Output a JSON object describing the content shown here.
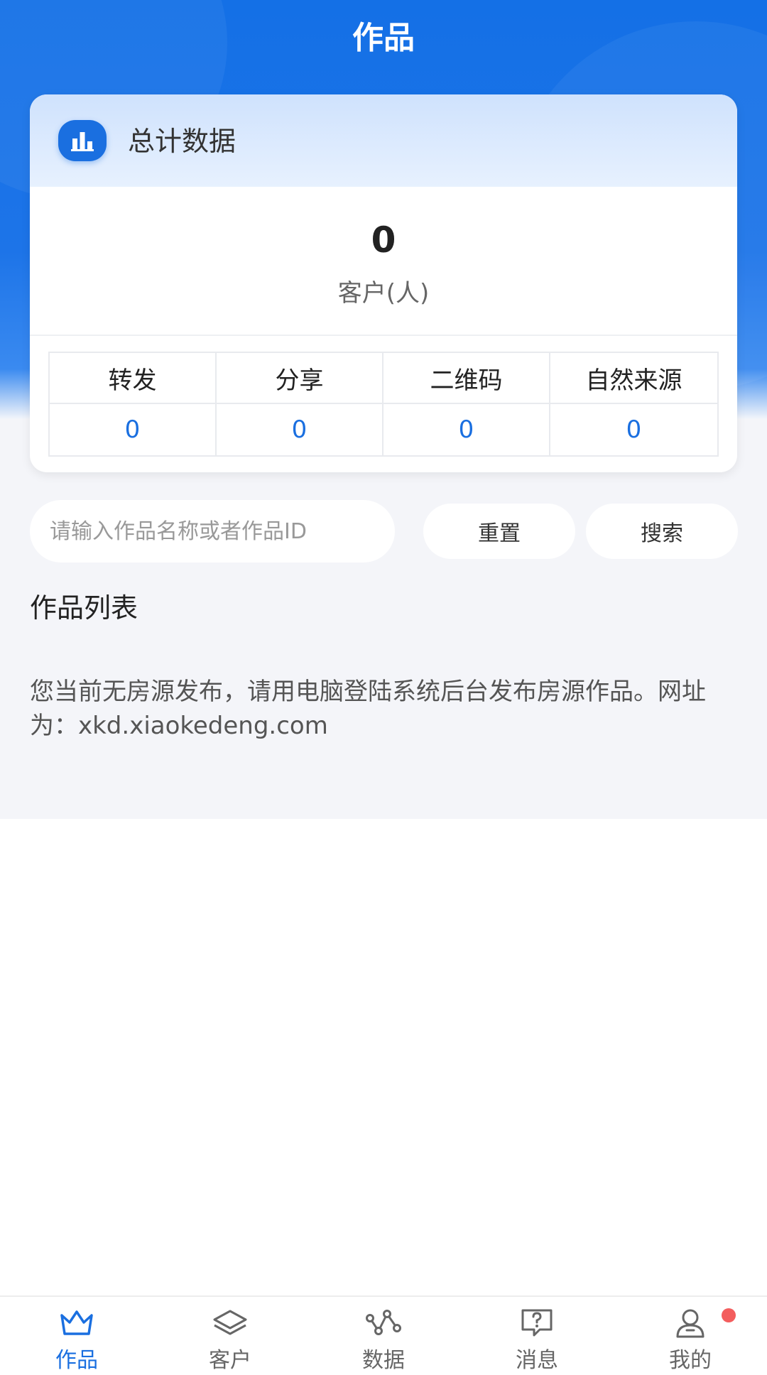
{
  "header": {
    "title": "作品"
  },
  "summary": {
    "title": "总计数据",
    "total_value": "0",
    "total_label": "客户(人)",
    "columns": [
      "转发",
      "分享",
      "二维码",
      "自然来源"
    ],
    "values": [
      "0",
      "0",
      "0",
      "0"
    ]
  },
  "search": {
    "placeholder": "请输入作品名称或者作品ID",
    "reset_label": "重置",
    "search_label": "搜索"
  },
  "list": {
    "title": "作品列表",
    "empty_text": "您当前无房源发布，请用电脑登陆系统后台发布房源作品。网址为：xkd.xiaokedeng.com"
  },
  "tabbar": {
    "items": [
      {
        "label": "作品",
        "icon": "crown-icon",
        "active": true
      },
      {
        "label": "客户",
        "icon": "layers-icon",
        "active": false
      },
      {
        "label": "数据",
        "icon": "nodes-icon",
        "active": false
      },
      {
        "label": "消息",
        "icon": "question-chat-icon",
        "active": false
      },
      {
        "label": "我的",
        "icon": "user-icon",
        "active": false
      }
    ]
  },
  "colors": {
    "brand": "#1a6fe0",
    "badge": "#f35d5d"
  }
}
